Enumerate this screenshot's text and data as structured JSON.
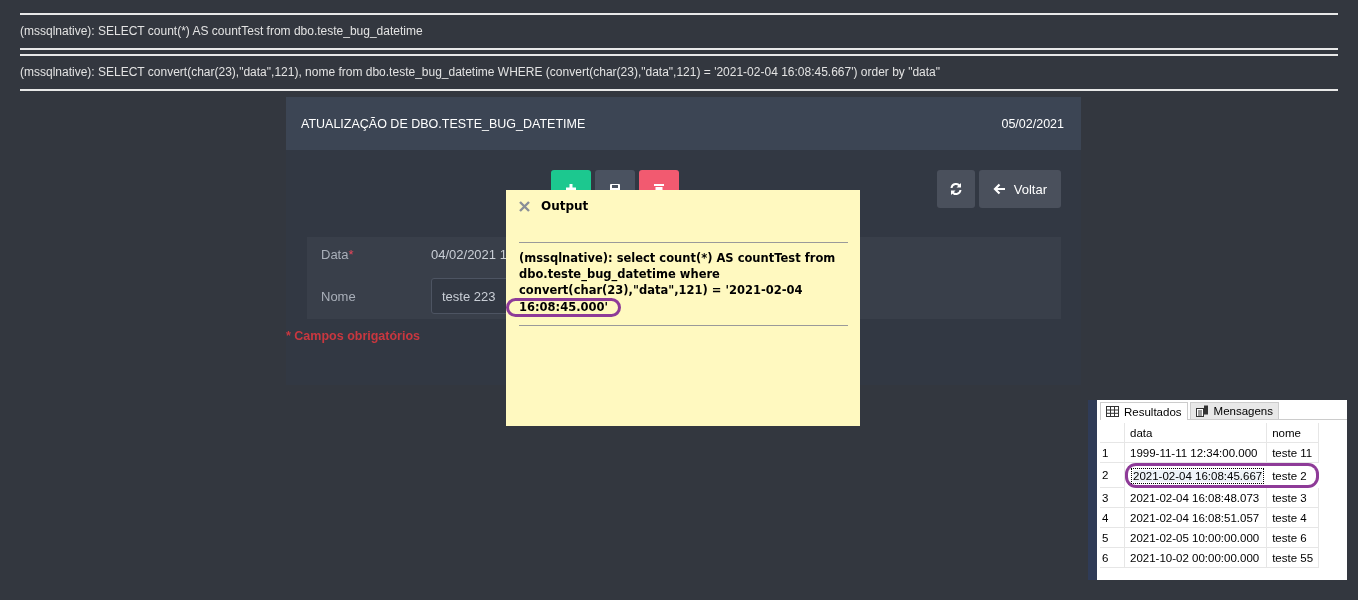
{
  "log_lines": [
    {
      "text": "(mssqlnative): SELECT count(*) AS countTest from dbo.teste_bug_datetime"
    },
    {
      "text": "(mssqlnative): SELECT convert(char(23),\"data\",121), nome from dbo.teste_bug_datetime WHERE (convert(char(23),\"data\",121) = '2021-02-04 16:08:45.667') order by \"data\""
    }
  ],
  "panel": {
    "title": "ATUALIZAÇÃO DE DBO.TESTE_BUG_DATETIME",
    "date": "05/02/2021",
    "actions": [
      {
        "kind": "new"
      },
      {
        "kind": "save"
      },
      {
        "kind": "delete"
      }
    ],
    "required_mark": "*",
    "back_label": "Voltar",
    "fields": [
      {
        "kind": "text",
        "label": "Data",
        "required": true,
        "value": "04/02/2021 1"
      },
      {
        "kind": "input",
        "label": "Nome",
        "required": false,
        "value": "teste 223"
      }
    ],
    "required_note": "* Campos obrigatórios"
  },
  "output_popup": {
    "title": "Output",
    "lines": [
      "(mssqlnative): select count(*) AS countTest from",
      "dbo.teste_bug_datetime where",
      "convert(char(23),\"data\",121) = '2021-02-04"
    ],
    "highlighted_line": "16:08:45.000'"
  },
  "results": {
    "tabs": [
      {
        "label": "Resultados",
        "selected": true
      },
      {
        "label": "Mensagens",
        "selected": false
      }
    ],
    "columns": [
      "data",
      "nome"
    ],
    "rows": [
      {
        "n": "1",
        "data": "1999-11-11 12:34:00.000",
        "nome": "teste 11",
        "selected": false
      },
      {
        "n": "2",
        "data": "2021-02-04 16:08:45.667",
        "nome": "teste 2",
        "selected": true
      },
      {
        "n": "3",
        "data": "2021-02-04 16:08:48.073",
        "nome": "teste 3",
        "selected": false
      },
      {
        "n": "4",
        "data": "2021-02-04 16:08:51.057",
        "nome": "teste 4",
        "selected": false
      },
      {
        "n": "5",
        "data": "2021-02-05 10:00:00.000",
        "nome": "teste 6",
        "selected": false
      },
      {
        "n": "6",
        "data": "2021-10-02 00:00:00.000",
        "nome": "teste 55",
        "selected": false
      }
    ]
  }
}
